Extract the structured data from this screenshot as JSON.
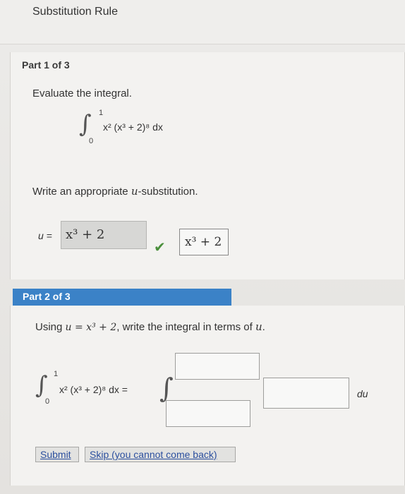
{
  "header": {
    "title": "Substitution Rule"
  },
  "part1": {
    "label": "Part 1 of 3",
    "prompt": "Evaluate the integral.",
    "integral": {
      "lower": "0",
      "upper": "1",
      "integrand": "x² (x³ + 2)⁸ dx"
    },
    "subst_prompt_prefix": "Write an appropriate ",
    "subst_prompt_var": "u",
    "subst_prompt_suffix": "-substitution.",
    "u_label": "u =",
    "u_value": "x³ + 2",
    "preview_value": "x³ + 2"
  },
  "part2": {
    "label": "Part 2 of 3",
    "prompt_prefix": "Using ",
    "prompt_eq": "u = x³ + 2",
    "prompt_suffix": ", write the integral in terms of ",
    "prompt_var": "u",
    "prompt_end": ".",
    "integral": {
      "lower": "0",
      "upper": "1",
      "integrand": "x² (x³ + 2)⁸ dx ="
    },
    "du_label": "du"
  },
  "buttons": {
    "submit": "Submit",
    "skip": "Skip (you cannot come back)"
  },
  "colors": {
    "part_bar": "#3b82c7",
    "check": "#4a8f3b"
  }
}
